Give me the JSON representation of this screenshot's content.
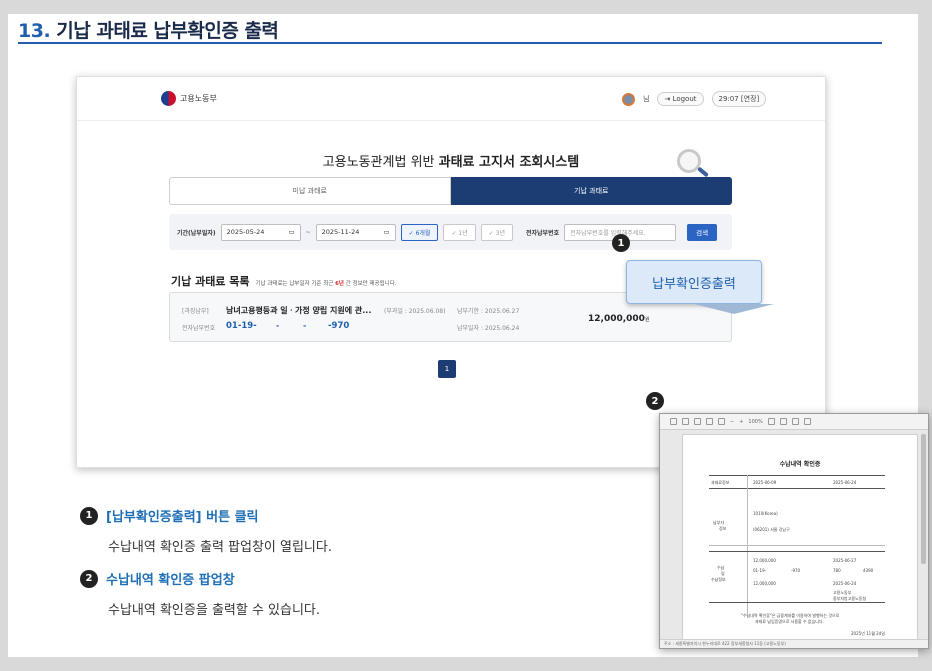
{
  "doc": {
    "num": "13.",
    "title": "기납 과태료 납부확인증 출력"
  },
  "app": {
    "logo_text": "고용노동부",
    "user_name": "님",
    "logout_label": "Logout",
    "timer": "29:07 [연장]",
    "system_title_pre": "고용노동관계법 위반",
    "system_title_bold": "과태료 고지서 조회시스템",
    "tabs": [
      {
        "label": "미납 과태료",
        "active": false
      },
      {
        "label": "기납 과태료",
        "active": true
      }
    ],
    "filter": {
      "period_label": "기간(납부일자)",
      "date_from": "2025-05-24",
      "date_to": "2025-11-24",
      "tilde": "~",
      "range_buttons": [
        "✓ 6개월",
        "✓ 1년",
        "✓ 3년"
      ],
      "payer_label": "전자납부번호",
      "payer_placeholder": "전자납부번호를 입력해주세요.",
      "search_label": "검색"
    },
    "list": {
      "title": "기납 과태료 목록",
      "note_pre": "기납 과태료는 납부일자 기준 최근",
      "note_red": "6년",
      "note_post": "간 정보만 제공됩니다.",
      "row": {
        "tag": "[과징납부]",
        "item": "남녀고용평등과 일ㆍ가정 양립 지원에 관...",
        "ref_date": "(부과일 : 2025.06.08)",
        "due": "납부기한 : 2025.06.27",
        "paid": "납부일자 : 2025.06.24",
        "payno_label": "전자납부번호",
        "payno_parts": [
          "01-19-",
          "-",
          "-",
          "-970"
        ],
        "amount": "12,000,000",
        "amount_unit": "원"
      }
    },
    "page": "1"
  },
  "callout_label": "납부확인증출력",
  "badges": [
    "1",
    "2"
  ],
  "receipt": {
    "zoom": "100%",
    "title": "수납내역 확인증",
    "sec1": "과태료정보",
    "sec2_a": "납부자",
    "sec2_b": "정보",
    "sec3_a": "수납",
    "sec3_b": "및",
    "sec3_c": "수납정보",
    "date1": "2025-06-09",
    "date2": "2025-06-24",
    "payno_tail": "1010(Korea)",
    "addr": "(06201) 서울 강남구",
    "amount": "12,000,000",
    "pay_date": "2025-06-27",
    "payno2": "01-19-",
    "code": "-970",
    "num2": "780",
    "num3": "4390",
    "pay_date2": "2025-06-24",
    "org": "고용노동부",
    "office": "중부지방고용노동청",
    "footer_note1": "\"수납내역 확인증\"은 금융계좌를 이용하여 발행하는 것으로",
    "footer_note2": "과태료 납입증명으로 사용할 수 없습니다.",
    "footer_date": "2025년 11월 24일",
    "status": "주소 : 세종특별자치시 한누리대로 422 정부세종청사 11동 (고용노동부)"
  },
  "steps": [
    {
      "num": "1",
      "title": "[납부확인증출력] 버튼 클릭",
      "desc": "수납내역 확인증 출력 팝업창이 열립니다."
    },
    {
      "num": "2",
      "title": "수납내역 확인증 팝업창",
      "desc": "수납내역 확인증을 출력할 수 있습니다."
    }
  ]
}
